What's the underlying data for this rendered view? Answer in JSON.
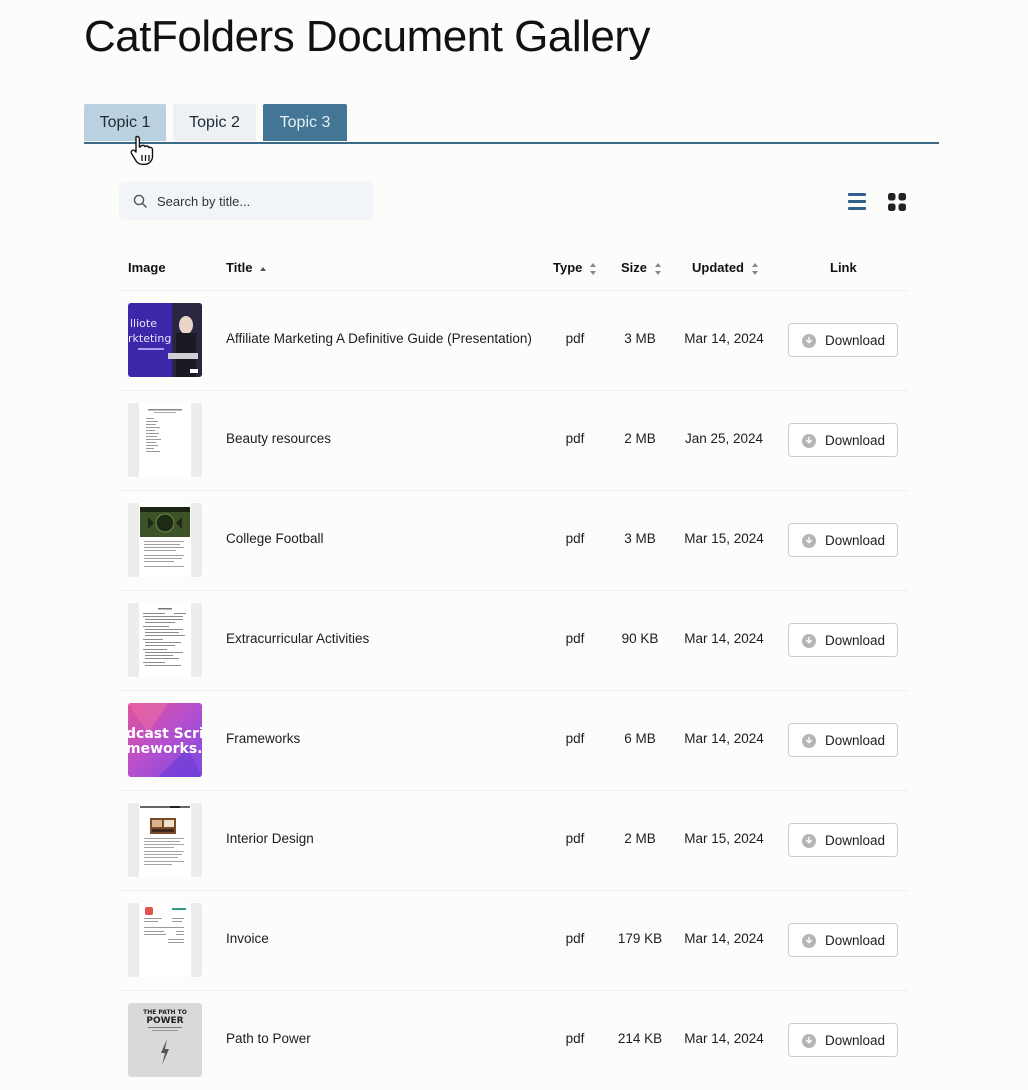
{
  "page": {
    "title": "CatFolders Document Gallery"
  },
  "tabs": [
    "Topic 1",
    "Topic 2",
    "Topic 3"
  ],
  "search": {
    "placeholder": "Search by title..."
  },
  "table": {
    "headers": {
      "image": "Image",
      "title": "Title",
      "type": "Type",
      "size": "Size",
      "updated": "Updated",
      "link": "Link"
    },
    "rows": [
      {
        "title": "Affiliate Marketing A Definitive Guide (Presentation)",
        "type": "pdf",
        "size": "3 MB",
        "updated": "Mar 14, 2024",
        "link": "Download"
      },
      {
        "title": "Beauty resources",
        "type": "pdf",
        "size": "2 MB",
        "updated": "Jan 25, 2024",
        "link": "Download"
      },
      {
        "title": "College Football",
        "type": "pdf",
        "size": "3 MB",
        "updated": "Mar 15, 2024",
        "link": "Download"
      },
      {
        "title": "Extracurricular Activities",
        "type": "pdf",
        "size": "90 KB",
        "updated": "Mar 14, 2024",
        "link": "Download"
      },
      {
        "title": "Frameworks",
        "type": "pdf",
        "size": "6 MB",
        "updated": "Mar 14, 2024",
        "link": "Download"
      },
      {
        "title": "Interior Design",
        "type": "pdf",
        "size": "2 MB",
        "updated": "Mar 15, 2024",
        "link": "Download"
      },
      {
        "title": "Invoice",
        "type": "pdf",
        "size": "179 KB",
        "updated": "Mar 14, 2024",
        "link": "Download"
      },
      {
        "title": "Path to Power",
        "type": "pdf",
        "size": "214 KB",
        "updated": "Mar 14, 2024",
        "link": "Download"
      }
    ]
  },
  "thumbnails": {
    "affiliate": [
      "lliote",
      "rkteting"
    ],
    "frameworks": [
      "dcast Script",
      "meworks."
    ],
    "path": [
      "THE PATH TO",
      "POWER"
    ]
  },
  "icons": {
    "search": "search-icon",
    "list_view": "list-view-icon",
    "grid_view": "grid-view-icon",
    "download": "download-icon",
    "sort": "sort-icon",
    "cursor": "hand-pointer-cursor-icon"
  },
  "colors": {
    "tab_active": "#427694",
    "tab_hover": "#b9d1e0",
    "tabs_underline": "#3a6a88",
    "view_icon_active": "#2f5f8a"
  }
}
